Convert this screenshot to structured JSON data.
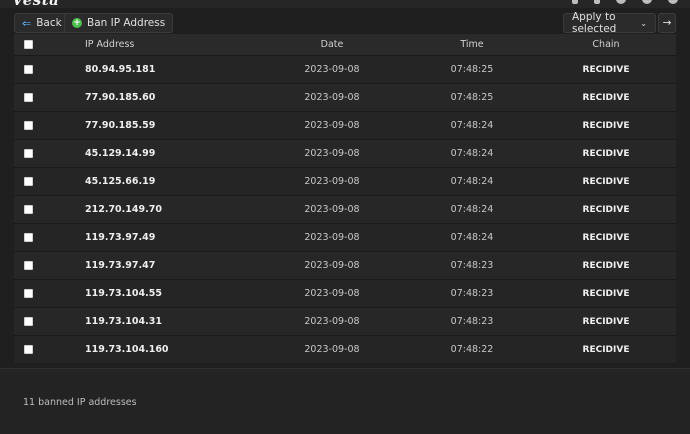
{
  "toolbar": {
    "back_label": "Back",
    "ban_label": "Ban IP Address",
    "apply_label": "Apply to selected",
    "go_label": "→"
  },
  "table": {
    "headers": [
      "IP Address",
      "Date",
      "Time",
      "Chain"
    ],
    "rows": [
      {
        "ip": "80.94.95.181",
        "date": "2023-09-08",
        "time": "07:48:25",
        "chain": "RECIDIVE"
      },
      {
        "ip": "77.90.185.60",
        "date": "2023-09-08",
        "time": "07:48:25",
        "chain": "RECIDIVE"
      },
      {
        "ip": "77.90.185.59",
        "date": "2023-09-08",
        "time": "07:48:24",
        "chain": "RECIDIVE"
      },
      {
        "ip": "45.129.14.99",
        "date": "2023-09-08",
        "time": "07:48:24",
        "chain": "RECIDIVE"
      },
      {
        "ip": "45.125.66.19",
        "date": "2023-09-08",
        "time": "07:48:24",
        "chain": "RECIDIVE"
      },
      {
        "ip": "212.70.149.70",
        "date": "2023-09-08",
        "time": "07:48:24",
        "chain": "RECIDIVE"
      },
      {
        "ip": "119.73.97.49",
        "date": "2023-09-08",
        "time": "07:48:24",
        "chain": "RECIDIVE"
      },
      {
        "ip": "119.73.97.47",
        "date": "2023-09-08",
        "time": "07:48:23",
        "chain": "RECIDIVE"
      },
      {
        "ip": "119.73.104.55",
        "date": "2023-09-08",
        "time": "07:48:23",
        "chain": "RECIDIVE"
      },
      {
        "ip": "119.73.104.31",
        "date": "2023-09-08",
        "time": "07:48:23",
        "chain": "RECIDIVE"
      },
      {
        "ip": "119.73.104.160",
        "date": "2023-09-08",
        "time": "07:48:22",
        "chain": "RECIDIVE"
      }
    ]
  },
  "footer": {
    "count_text": "11 banned IP addresses"
  }
}
